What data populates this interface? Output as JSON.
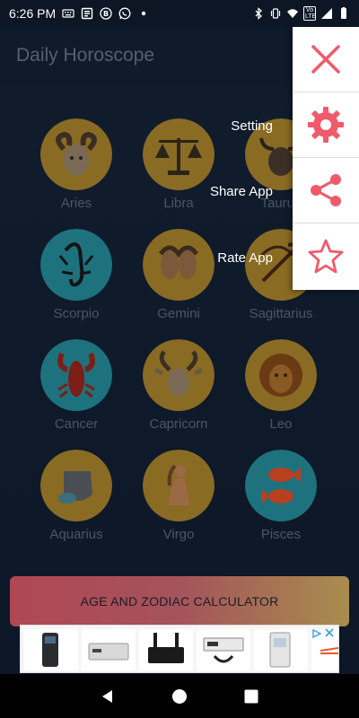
{
  "status_bar": {
    "time": "6:26 PM",
    "left_icons": [
      "keyboard-icon",
      "news-icon",
      "b-circle-icon",
      "whatsapp-icon",
      "dot-icon"
    ],
    "right_icons": [
      "bluetooth-icon",
      "vibrate-icon",
      "wifi-icon",
      "volte-icon",
      "signal-icon",
      "battery-icon"
    ],
    "volte_text": "Vo LTE"
  },
  "app_bar": {
    "title": "Daily Horoscope"
  },
  "zodiac_signs": [
    {
      "name": "Aries",
      "color": "#e0a82e"
    },
    {
      "name": "Libra",
      "color": "#e0a82e"
    },
    {
      "name": "Taurus",
      "color": "#e0a82e"
    },
    {
      "name": "Scorpio",
      "color": "#2bb6c8"
    },
    {
      "name": "Gemini",
      "color": "#e0a82e"
    },
    {
      "name": "Sagittarius",
      "color": "#e0a82e"
    },
    {
      "name": "Cancer",
      "color": "#2bb6c8"
    },
    {
      "name": "Capricorn",
      "color": "#e0a82e"
    },
    {
      "name": "Leo",
      "color": "#e0a82e"
    },
    {
      "name": "Aquarius",
      "color": "#e0a82e"
    },
    {
      "name": "Virgo",
      "color": "#e0a82e"
    },
    {
      "name": "Pisces",
      "color": "#2bb6c8"
    }
  ],
  "calculator_button": {
    "label": "AGE AND ZODIAC CALCULATOR"
  },
  "menu": {
    "items": [
      {
        "label": "",
        "icon": "close-icon"
      },
      {
        "label": "Setting",
        "icon": "gear-icon"
      },
      {
        "label": "Share App",
        "icon": "share-icon"
      },
      {
        "label": "Rate App",
        "icon": "star-icon"
      }
    ],
    "accent_color": "#f05a6a"
  },
  "nav_bar": {
    "buttons": [
      "back-icon",
      "home-icon",
      "recents-icon"
    ]
  }
}
